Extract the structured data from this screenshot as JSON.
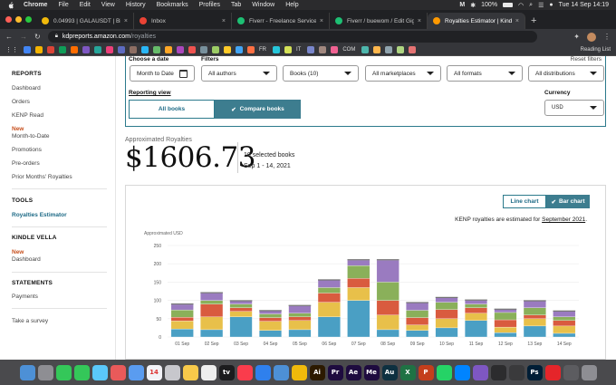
{
  "menubar": {
    "app": "Chrome",
    "menus": [
      "File",
      "Edit",
      "View",
      "History",
      "Bookmarks",
      "Profiles",
      "Tab",
      "Window",
      "Help"
    ],
    "battery": "100%",
    "datetime": "Tue 14 Sep  14:19"
  },
  "tabs": [
    {
      "title": "0.04993 | GALAUSDT | Binan",
      "color": "#f0b90b",
      "active": false
    },
    {
      "title": "Inbox",
      "color": "#ea4335",
      "active": false
    },
    {
      "title": "Fiverr - Freelance Services M",
      "color": "#1dbf73",
      "active": false
    },
    {
      "title": "Fiverr / buewom / Edit Gig",
      "color": "#1dbf73",
      "active": false
    },
    {
      "title": "Royalties Estimator | Kindle D",
      "color": "#ff9900",
      "active": true
    }
  ],
  "toolbar": {
    "url_host": "kdpreports.amazon.com",
    "url_path": "/royalties"
  },
  "bookmarks": {
    "labels": [
      "FR",
      "IT",
      "COM"
    ],
    "reading_list": "Reading List",
    "colors": [
      "#4285f4",
      "#f4b400",
      "#db4437",
      "#0f9d58",
      "#ff6d00",
      "#7e57c2",
      "#26a69a",
      "#ec407a",
      "#5c6bc0",
      "#8d6e63",
      "#29b6f6",
      "#66bb6a",
      "#ffa726",
      "#ab47bc",
      "#ef5350",
      "#78909c",
      "#9ccc65",
      "#ffca28",
      "#42a5f5",
      "#ff7043",
      "#26c6da",
      "#d4e157",
      "#7986cb",
      "#a1887f",
      "#f06292",
      "#4db6ac",
      "#ffb74d",
      "#90a4ae",
      "#aed581",
      "#e57373"
    ]
  },
  "sidebar": {
    "reports_heading": "REPORTS",
    "reports": [
      "Dashboard",
      "Orders",
      "KENP Read"
    ],
    "new_label": "New",
    "reports_more": [
      "Month-to-Date",
      "Promotions",
      "Pre-orders",
      "Prior Months' Royalties"
    ],
    "tools_heading": "TOOLS",
    "tools_item": "Royalties Estimator",
    "vella_heading": "KINDLE VELLA",
    "vella_item": "Dashboard",
    "statements_heading": "STATEMENTS",
    "statements_item": "Payments",
    "survey": "Take a survey"
  },
  "filters": {
    "choose_date_label": "Choose a date",
    "filters_label": "Filters",
    "reset_label": "Reset filters",
    "date_value": "Month to Date",
    "authors": "All authors",
    "books": "Books (10)",
    "marketplaces": "All marketplaces",
    "formats": "All formats",
    "distributions": "All distributions",
    "reporting_view_label": "Reporting view",
    "all_books": "All books",
    "compare_books": "Compare books",
    "currency_label": "Currency",
    "currency_value": "USD"
  },
  "royalties": {
    "label": "Approximated Royalties",
    "value": "$1606.73",
    "selected_books": "10 selected books",
    "date_range": "Sep 1 - 14, 2021"
  },
  "chart_controls": {
    "line_chart": "Line chart",
    "bar_chart": "Bar chart",
    "note_prefix": "KENP royalties are estimated for ",
    "note_link": "September 2021",
    "note_suffix": "."
  },
  "chart_data": {
    "type": "bar",
    "stacked": true,
    "ylabel": "Approximated USD",
    "ylim": [
      0,
      250
    ],
    "yticks": [
      0,
      50,
      100,
      150,
      200,
      250
    ],
    "categories": [
      "01 Sep",
      "02 Sep",
      "03 Sep",
      "04 Sep",
      "05 Sep",
      "06 Sep",
      "07 Sep",
      "08 Sep",
      "09 Sep",
      "10 Sep",
      "11 Sep",
      "12 Sep",
      "13 Sep",
      "14 Sep"
    ],
    "series": [
      {
        "color": "#4a9fc4",
        "values": [
          22,
          20,
          55,
          18,
          20,
          55,
          100,
          20,
          18,
          25,
          45,
          12,
          30,
          10
        ]
      },
      {
        "color": "#e8c04a",
        "values": [
          22,
          35,
          15,
          25,
          25,
          40,
          35,
          40,
          15,
          25,
          20,
          15,
          20,
          20
        ]
      },
      {
        "color": "#d95b3f",
        "values": [
          10,
          35,
          10,
          10,
          10,
          25,
          25,
          40,
          20,
          25,
          15,
          20,
          10,
          15
        ]
      },
      {
        "color": "#8ab05a",
        "values": [
          20,
          10,
          10,
          10,
          10,
          15,
          35,
          50,
          20,
          20,
          10,
          20,
          20,
          10
        ]
      },
      {
        "color": "#9a7bc0",
        "values": [
          15,
          20,
          8,
          8,
          20,
          20,
          15,
          60,
          20,
          12,
          10,
          8,
          18,
          15
        ]
      }
    ]
  },
  "dock": [
    {
      "label": "",
      "color": "#4d90d6"
    },
    {
      "label": "",
      "color": "#8e8e93"
    },
    {
      "label": "",
      "color": "#34c759"
    },
    {
      "label": "",
      "color": "#34c759"
    },
    {
      "label": "",
      "color": "#5ac8fa"
    },
    {
      "label": "",
      "color": "#e95a5a"
    },
    {
      "label": "",
      "color": "#5a9cf0"
    },
    {
      "label": "14",
      "color": "#f2f2f7"
    },
    {
      "label": "",
      "color": "#c7c7cc"
    },
    {
      "label": "",
      "color": "#f7c94a"
    },
    {
      "label": "",
      "color": "#eeeeee"
    },
    {
      "label": "tv",
      "color": "#1c1c1e"
    },
    {
      "label": "",
      "color": "#fa3c4c"
    },
    {
      "label": "",
      "color": "#2f80ed"
    },
    {
      "label": "",
      "color": "#4d90d6"
    },
    {
      "label": "",
      "color": "#f0b90b"
    },
    {
      "label": "Ai",
      "color": "#2c1a00"
    },
    {
      "label": "Pr",
      "color": "#1e0b3f"
    },
    {
      "label": "Ae",
      "color": "#1e0b3f"
    },
    {
      "label": "Me",
      "color": "#1e0b3f"
    },
    {
      "label": "Au",
      "color": "#0e3040"
    },
    {
      "label": "X",
      "color": "#1f7244"
    },
    {
      "label": "P",
      "color": "#c43e1c"
    },
    {
      "label": "",
      "color": "#25d366"
    },
    {
      "label": "",
      "color": "#0084ff"
    },
    {
      "label": "",
      "color": "#7e57c2"
    },
    {
      "label": "",
      "color": "#2c2c2e"
    },
    {
      "label": "",
      "color": "#3a3a3c"
    },
    {
      "label": "Ps",
      "color": "#001e36"
    },
    {
      "label": "",
      "color": "#e5252a"
    },
    {
      "label": "",
      "color": "#5c5c60"
    },
    {
      "label": "",
      "color": "#8e8e93"
    }
  ]
}
